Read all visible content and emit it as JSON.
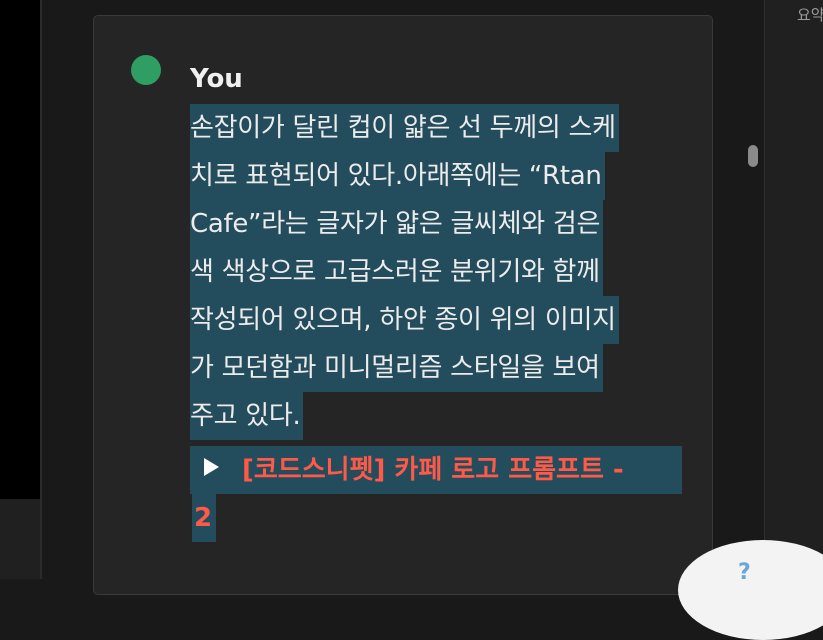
{
  "sidebar": {
    "summary_label": "요약"
  },
  "comment": {
    "author": "You",
    "avatar_color": "#2e9e62",
    "lines": [
      "손잡이가 달린 컵이 얇은 선 두께의 스케",
      "치로 표현되어 있다.아래쪽에는 “Rtan ",
      "Cafe”라는 글자가 얇은 글씨체와 검은 ",
      "색 색상으로 고급스러운 분위기와 함께 ",
      "작성되어 있으며, 하얀 종이 위의 이미지",
      "가 모던함과 미니멀리즘 스타일을 보여 ",
      "주고 있다."
    ],
    "toggle": {
      "icon": "triangle-right-icon",
      "line1": "[코드스니펫] 카페 로고 프롬프트 -",
      "line2": "2"
    }
  },
  "help": {
    "icon_label": "?"
  },
  "colors": {
    "highlight": "#234c5c",
    "toggle_text": "#ff5a47",
    "background": "#191919",
    "card": "#252525"
  }
}
